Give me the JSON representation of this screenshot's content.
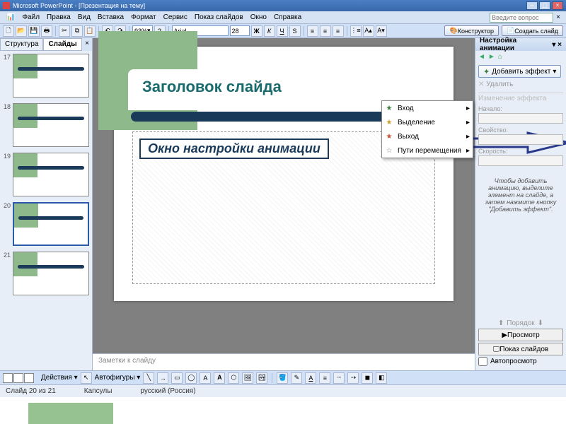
{
  "title": "Microsoft PowerPoint - [Презентация на тему]",
  "menu": {
    "file": "Файл",
    "edit": "Правка",
    "view": "Вид",
    "insert": "Вставка",
    "format": "Формат",
    "tools": "Сервис",
    "slideshow": "Показ слайдов",
    "window": "Окно",
    "help": "Справка"
  },
  "question_box": "Введите вопрос",
  "toolbar": {
    "zoom": "93%",
    "font": "Arial",
    "size": "28",
    "designer": "Конструктор",
    "newslide": "Создать слайд"
  },
  "left": {
    "tab_outline": "Структура",
    "tab_slides": "Слайды",
    "nums": [
      "17",
      "18",
      "19",
      "20",
      "21"
    ]
  },
  "slide": {
    "title": "Заголовок слайда",
    "caption": "Окно настройки анимации"
  },
  "notes": "Заметки к слайду",
  "popup": {
    "entry": "Вход",
    "emphasis": "Выделение",
    "exit": "Выход",
    "motion": "Пути перемещения"
  },
  "right": {
    "header": "Настройка анимации",
    "add": "Добавить эффект",
    "remove": "Удалить",
    "change_label": "Изменение эффекта",
    "start": "Начало:",
    "prop": "Свойство:",
    "speed": "Скорость:",
    "hint": "Чтобы добавить анимацию, выделите элемент на слайде, а затем нажмите кнопку \"Добавить эффект\".",
    "reorder": "Порядок",
    "play": "Просмотр",
    "show": "Показ слайдов",
    "auto": "Автопросмотр"
  },
  "bottom": {
    "actions": "Действия",
    "autoshapes": "Автофигуры"
  },
  "status": {
    "slide": "Слайд 20 из 21",
    "theme": "Капсулы",
    "lang": "русский (Россия)"
  }
}
